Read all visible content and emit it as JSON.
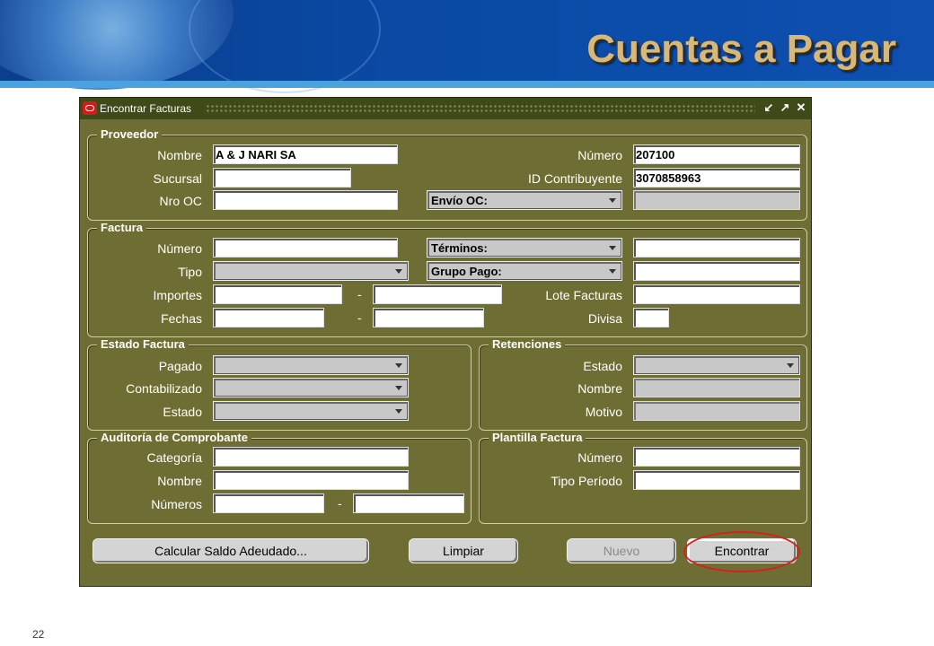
{
  "slide": {
    "title": "Cuentas a Pagar",
    "page_number": "22"
  },
  "window": {
    "title": "Encontrar Facturas"
  },
  "proveedor": {
    "title": "Proveedor",
    "nombre_label": "Nombre",
    "nombre_value": "A & J NARI SA",
    "sucursal_label": "Sucursal",
    "nro_oc_label": "Nro OC",
    "numero_label": "Número",
    "numero_value": "207100",
    "id_contribuyente_label": "ID Contribuyente",
    "id_contribuyente_value": "3070858963",
    "envio_oc_label": "Envío OC:"
  },
  "factura": {
    "title": "Factura",
    "numero_label": "Número",
    "tipo_label": "Tipo",
    "importes_label": "Importes",
    "fechas_label": "Fechas",
    "terminos_label": "Términos:",
    "grupo_pago_label": "Grupo Pago:",
    "lote_facturas_label": "Lote Facturas",
    "divisa_label": "Divisa",
    "range_separator": "-"
  },
  "estado_factura": {
    "title": "Estado Factura",
    "pagado_label": "Pagado",
    "contabilizado_label": "Contabilizado",
    "estado_label": "Estado"
  },
  "retenciones": {
    "title": "Retenciones",
    "estado_label": "Estado",
    "nombre_label": "Nombre",
    "motivo_label": "Motivo"
  },
  "auditoria": {
    "title": "Auditoría de Comprobante",
    "categoria_label": "Categoría",
    "nombre_label": "Nombre",
    "numeros_label": "Números",
    "range_separator": "-"
  },
  "plantilla": {
    "title": "Plantilla Factura",
    "numero_label": "Número",
    "tipo_periodo_label": "Tipo Período"
  },
  "buttons": {
    "calcular": "Calcular Saldo Adeudado...",
    "limpiar": "Limpiar",
    "nuevo": "Nuevo",
    "encontrar": "Encontrar"
  },
  "colors": {
    "window_bg": "#6e6e34",
    "titlebar_bg": "#3e4a18",
    "slide_title": "#d7b878",
    "highlight": "#d81e1e"
  }
}
